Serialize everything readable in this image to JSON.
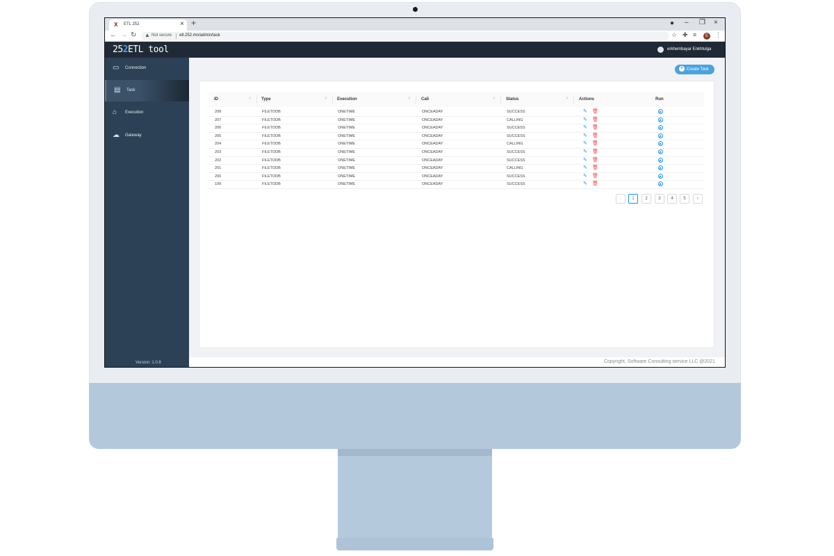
{
  "browser": {
    "tab_title": "ETL 252",
    "tab_favicon": "X",
    "new_tab": "+",
    "security": "Not secure",
    "url": "etl.252.mn/admin/task",
    "profile_initial": "E"
  },
  "app": {
    "logo_a": "25",
    "logo_b": "2",
    "logo_c": "ETL tool",
    "user_name": "erkhembayar Enkhtulga",
    "version": "Version: 1.0.8",
    "create_button": "Create Task",
    "copyright": "Copyright, Software Consulting service LLC @2021"
  },
  "sidebar": {
    "items": [
      {
        "label": "Connection",
        "icon": "monitor-icon"
      },
      {
        "label": "Task",
        "icon": "task-icon"
      },
      {
        "label": "Execution",
        "icon": "home-icon"
      },
      {
        "label": "Gateway",
        "icon": "cloud-icon"
      }
    ],
    "active": "Task"
  },
  "table": {
    "columns": [
      "ID",
      "Type",
      "Execution",
      "Call",
      "Status",
      "Actions",
      "Run"
    ],
    "rows": [
      {
        "id": "208",
        "type": "FILETODB",
        "execution": "ONETIME",
        "call": "ONCEADAY",
        "status": "SUCCESS"
      },
      {
        "id": "207",
        "type": "FILETODB",
        "execution": "ONETIME",
        "call": "ONCEADAY",
        "status": "CALLING"
      },
      {
        "id": "206",
        "type": "FILETODB",
        "execution": "ONETIME",
        "call": "ONCEADAY",
        "status": "SUCCESS"
      },
      {
        "id": "205",
        "type": "FILETODB",
        "execution": "ONETIME",
        "call": "ONCEADAY",
        "status": "SUCCESS"
      },
      {
        "id": "204",
        "type": "FILETODB",
        "execution": "ONETIME",
        "call": "ONCEADAY",
        "status": "CALLING"
      },
      {
        "id": "203",
        "type": "FILETODB",
        "execution": "ONETIME",
        "call": "ONCEADAY",
        "status": "SUCCESS"
      },
      {
        "id": "202",
        "type": "FILETODB",
        "execution": "ONETIME",
        "call": "ONCEADAY",
        "status": "SUCCESS"
      },
      {
        "id": "201",
        "type": "FILETODB",
        "execution": "ONETIME",
        "call": "ONCEADAY",
        "status": "CALLING"
      },
      {
        "id": "200",
        "type": "FILETODB",
        "execution": "ONETIME",
        "call": "ONCEADAY",
        "status": "SUCCESS"
      },
      {
        "id": "199",
        "type": "FILETODB",
        "execution": "ONETIME",
        "call": "ONCEADAY",
        "status": "SUCCESS"
      }
    ]
  },
  "pagination": {
    "prev": "‹",
    "pages": [
      "1",
      "2",
      "3",
      "4",
      "5"
    ],
    "next": "›",
    "current": "1"
  },
  "colors": {
    "header": "#1f2a36",
    "sidebar": "#2c4156",
    "accent": "#4aa3df",
    "delete": "#ff4d4f"
  }
}
